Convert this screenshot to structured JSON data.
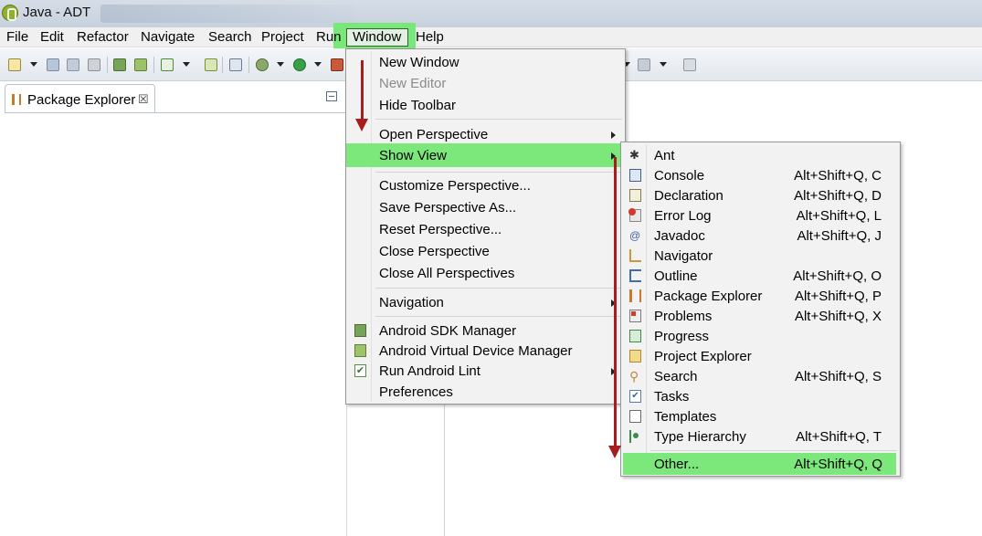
{
  "window": {
    "title": "Java - ADT"
  },
  "menubar": {
    "items": [
      "File",
      "Edit",
      "Refactor",
      "Navigate",
      "Search",
      "Project",
      "Run",
      "Window",
      "Help"
    ]
  },
  "left_panel": {
    "tab_label": "Package Explorer",
    "tab_close": "☒"
  },
  "window_menu": {
    "items": [
      {
        "label": "New Window"
      },
      {
        "label": "New Editor",
        "disabled": true
      },
      {
        "label": "Hide Toolbar"
      },
      {
        "label": "Open Perspective",
        "submenu": true
      },
      {
        "label": "Show View",
        "submenu": true,
        "highlighted": true
      },
      {
        "label": "Customize Perspective..."
      },
      {
        "label": "Save Perspective As..."
      },
      {
        "label": "Reset Perspective..."
      },
      {
        "label": "Close Perspective"
      },
      {
        "label": "Close All Perspectives"
      },
      {
        "label": "Navigation",
        "submenu": true
      },
      {
        "label": "Android SDK Manager",
        "icon": "download-icon"
      },
      {
        "label": "Android Virtual Device Manager",
        "icon": "android-device-icon"
      },
      {
        "label": "Run Android Lint",
        "icon": "checkbox-icon",
        "submenu": true
      },
      {
        "label": "Preferences"
      }
    ]
  },
  "show_view_menu": {
    "items": [
      {
        "label": "Ant",
        "shortcut": "",
        "icon": "ant-icon"
      },
      {
        "label": "Console",
        "shortcut": "Alt+Shift+Q, C",
        "icon": "console-icon"
      },
      {
        "label": "Declaration",
        "shortcut": "Alt+Shift+Q, D",
        "icon": "declaration-icon"
      },
      {
        "label": "Error Log",
        "shortcut": "Alt+Shift+Q, L",
        "icon": "error-log-icon"
      },
      {
        "label": "Javadoc",
        "shortcut": "Alt+Shift+Q, J",
        "icon": "javadoc-icon"
      },
      {
        "label": "Navigator",
        "shortcut": "",
        "icon": "navigator-icon"
      },
      {
        "label": "Outline",
        "shortcut": "Alt+Shift+Q, O",
        "icon": "outline-icon"
      },
      {
        "label": "Package Explorer",
        "shortcut": "Alt+Shift+Q, P",
        "icon": "package-icon"
      },
      {
        "label": "Problems",
        "shortcut": "Alt+Shift+Q, X",
        "icon": "problems-icon"
      },
      {
        "label": "Progress",
        "shortcut": "",
        "icon": "progress-icon"
      },
      {
        "label": "Project Explorer",
        "shortcut": "",
        "icon": "folder-icon"
      },
      {
        "label": "Search",
        "shortcut": "Alt+Shift+Q, S",
        "icon": "search-icon"
      },
      {
        "label": "Tasks",
        "shortcut": "",
        "icon": "tasks-icon"
      },
      {
        "label": "Templates",
        "shortcut": "",
        "icon": "templates-icon"
      },
      {
        "label": "Type Hierarchy",
        "shortcut": "Alt+Shift+Q, T",
        "icon": "hierarchy-icon"
      },
      {
        "label": "Other...",
        "shortcut": "Alt+Shift+Q, Q",
        "highlighted": true
      }
    ]
  },
  "colors": {
    "highlight": "#7ce87c",
    "arrow": "#a71d1d",
    "menu_bg": "#f2f2f2"
  }
}
